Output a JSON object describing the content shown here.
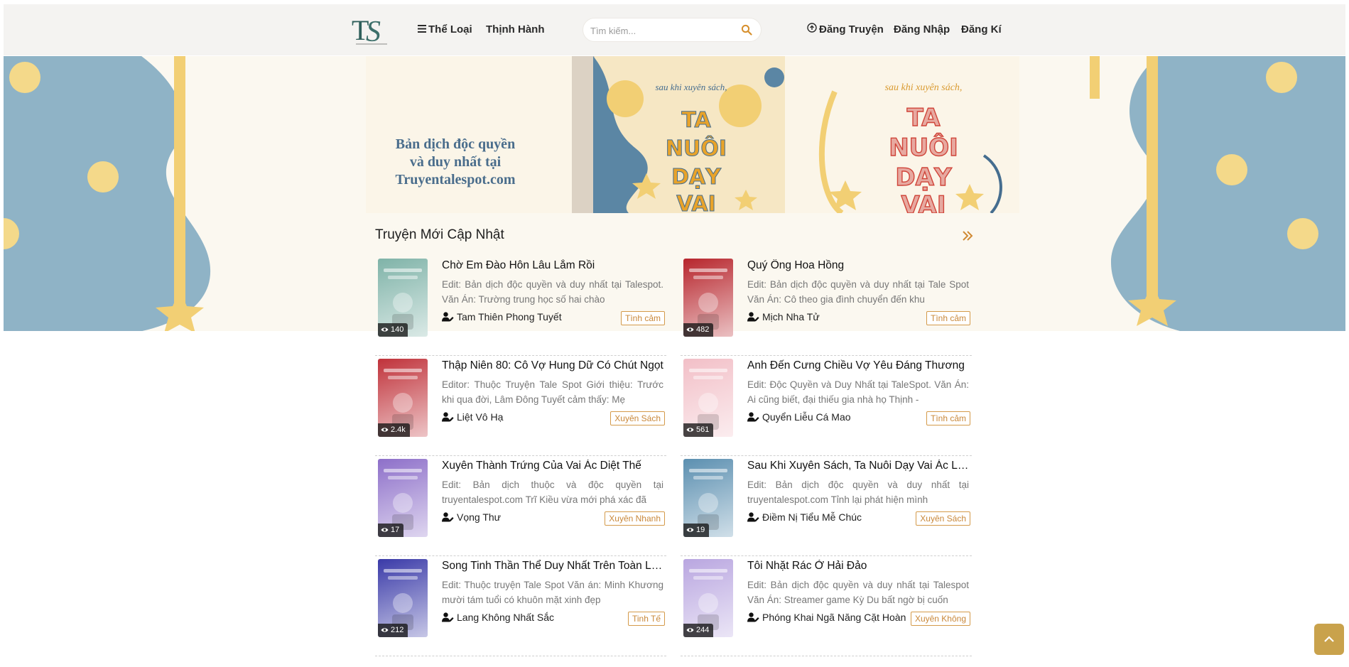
{
  "header": {
    "logo_text": "TS",
    "nav": {
      "categories": "Thể Loại",
      "trending": "Thịnh Hành",
      "post_story": "Đăng Truyện",
      "login": "Đăng Nhập",
      "register": "Đăng Kí"
    },
    "search": {
      "placeholder": "Tìm kiếm..."
    }
  },
  "banner": {
    "line1": "Bản dịch độc quyền",
    "line2": "và duy nhất tại",
    "line3": "Truyentalespot.com",
    "book_top": "sau khi xuyên sách,",
    "book_title": "TA NUÔI DẠY VAI ÁC"
  },
  "section": {
    "title": "Truyện Mới Cập Nhật"
  },
  "stories": [
    {
      "title": "Chờ Em Đào Hôn Lâu Lắm Rồi",
      "desc": "Edit: Bản dịch độc quyền và duy nhất tại Talespot. Văn Án: Trường trung học số hai chào",
      "author": "Tam Thiên Phong Tuyết",
      "genre": "Tình cảm",
      "views": "140",
      "cover_color": "#7fb3a8"
    },
    {
      "title": "Quý Ông Hoa Hồng",
      "desc": "Edit: Bản dịch độc quyền và duy nhất tại Tale Spot Văn Án: Cô theo gia đình chuyển đến khu",
      "author": "Mịch Nha Tử",
      "genre": "Tình cảm",
      "views": "482",
      "cover_color": "#b7252c"
    },
    {
      "title": "Thập Niên 80: Cô Vợ Hung Dữ Có Chút Ngọt",
      "desc": "Editor: Thuộc Truyện Tale Spot Giới thiệu: Trước khi qua đời, Lâm Đông Tuyết cảm thấy: Mẹ",
      "author": "Liệt Vô Hạ",
      "genre": "Xuyên Sách",
      "views": "2.4k",
      "cover_color": "#c0323a"
    },
    {
      "title": "Anh Đến Cưng Chiều Vợ Yêu Đáng Thương",
      "desc": "Edit: Độc Quyền và Duy Nhất tại TaleSpot. Văn Án: Ai cũng biết, đại thiếu gia nhà họ Thịnh -",
      "author": "Quyển Liễu Cá Mao",
      "genre": "Tình cảm",
      "views": "561",
      "cover_color": "#f2bfc7"
    },
    {
      "title": "Xuyên Thành Trứng Của Vai Ác Diệt Thế",
      "desc": "Edit: Bản dịch thuộc và độc quyền tại truyentalespot.com Trĩ Kiều vừa mới phá xác đã",
      "author": "Vọng Thư",
      "genre": "Xuyên Nhanh",
      "views": "17",
      "cover_color": "#8d6fc9"
    },
    {
      "title": "Sau Khi Xuyên Sách, Ta Nuôi Dạy Vai Ác Lúc Còn Bé",
      "desc": "Edit: Bản dịch độc quyền và duy nhất tại truyentalespot.com Tỉnh lại phát hiện mình",
      "author": "Điềm Nị Tiểu Mễ Chúc",
      "genre": "Xuyên Sách",
      "views": "19",
      "cover_color": "#5b8fb0"
    },
    {
      "title": "Song Tinh Thần Thể Duy Nhất Trên Toàn Liên Bang",
      "desc": "Edit: Thuộc truyện Tale Spot Văn án: Minh Khương mười tám tuổi có khuôn mặt xinh đẹp",
      "author": "Lang Không Nhất Sắc",
      "genre": "Tinh Tế",
      "views": "212",
      "cover_color": "#3a3aa8"
    },
    {
      "title": "Tôi Nhặt Rác Ở Hải Đảo",
      "desc": "Edit: Bản dịch độc quyền và duy nhất tại Talespot Văn Án: Streamer game Kỳ Du bất ngờ bị cuốn",
      "author": "Phóng Khai Ngã Năng Cặt Hoàn",
      "genre": "Xuyên Không",
      "views": "244",
      "cover_color": "#b9a6e0"
    }
  ]
}
